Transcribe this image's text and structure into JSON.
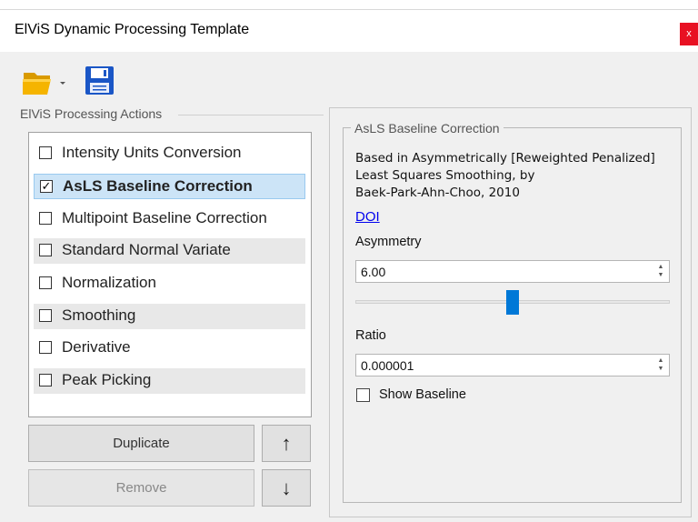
{
  "window": {
    "title": "ElViS Dynamic Processing Template",
    "close_label": "x"
  },
  "toolbar": {
    "open_icon": "folder-open-icon",
    "save_icon": "save-disk-icon"
  },
  "actions_group": {
    "caption": "ElViS Processing Actions",
    "items": [
      {
        "label": "Intensity Units Conversion",
        "checked": false,
        "selected": false
      },
      {
        "label": "AsLS Baseline Correction",
        "checked": true,
        "selected": true
      },
      {
        "label": "Multipoint Baseline Correction",
        "checked": false,
        "selected": false
      },
      {
        "label": "Standard Normal Variate",
        "checked": false,
        "selected": false
      },
      {
        "label": "Normalization",
        "checked": false,
        "selected": false
      },
      {
        "label": "Smoothing",
        "checked": false,
        "selected": false
      },
      {
        "label": "Derivative",
        "checked": false,
        "selected": false
      },
      {
        "label": "Peak Picking",
        "checked": false,
        "selected": false
      }
    ],
    "check_mark": "☑"
  },
  "buttons": {
    "duplicate": "Duplicate",
    "remove": "Remove",
    "move_up": "↑",
    "move_down": "↓"
  },
  "details": {
    "caption": "AsLS Baseline Correction",
    "description_line1": "Based in Asymmetrically [Reweighted Penalized]",
    "description_line2": "Least Squares Smoothing, by",
    "description_line3": "Baek-Park-Ahn-Choo, 2010",
    "doi_link": "DOI",
    "asymmetry": {
      "label": "Asymmetry",
      "value": "6.00",
      "slider_fraction": 0.5
    },
    "ratio": {
      "label": "Ratio",
      "value": "0.000001"
    },
    "show_baseline": {
      "label": "Show Baseline",
      "checked": false
    }
  },
  "colors": {
    "selection_bg": "#cce4f7",
    "accent": "#0078d7",
    "close_red": "#e81123",
    "folder": "#f5b400",
    "save_blue": "#1a56c6"
  }
}
